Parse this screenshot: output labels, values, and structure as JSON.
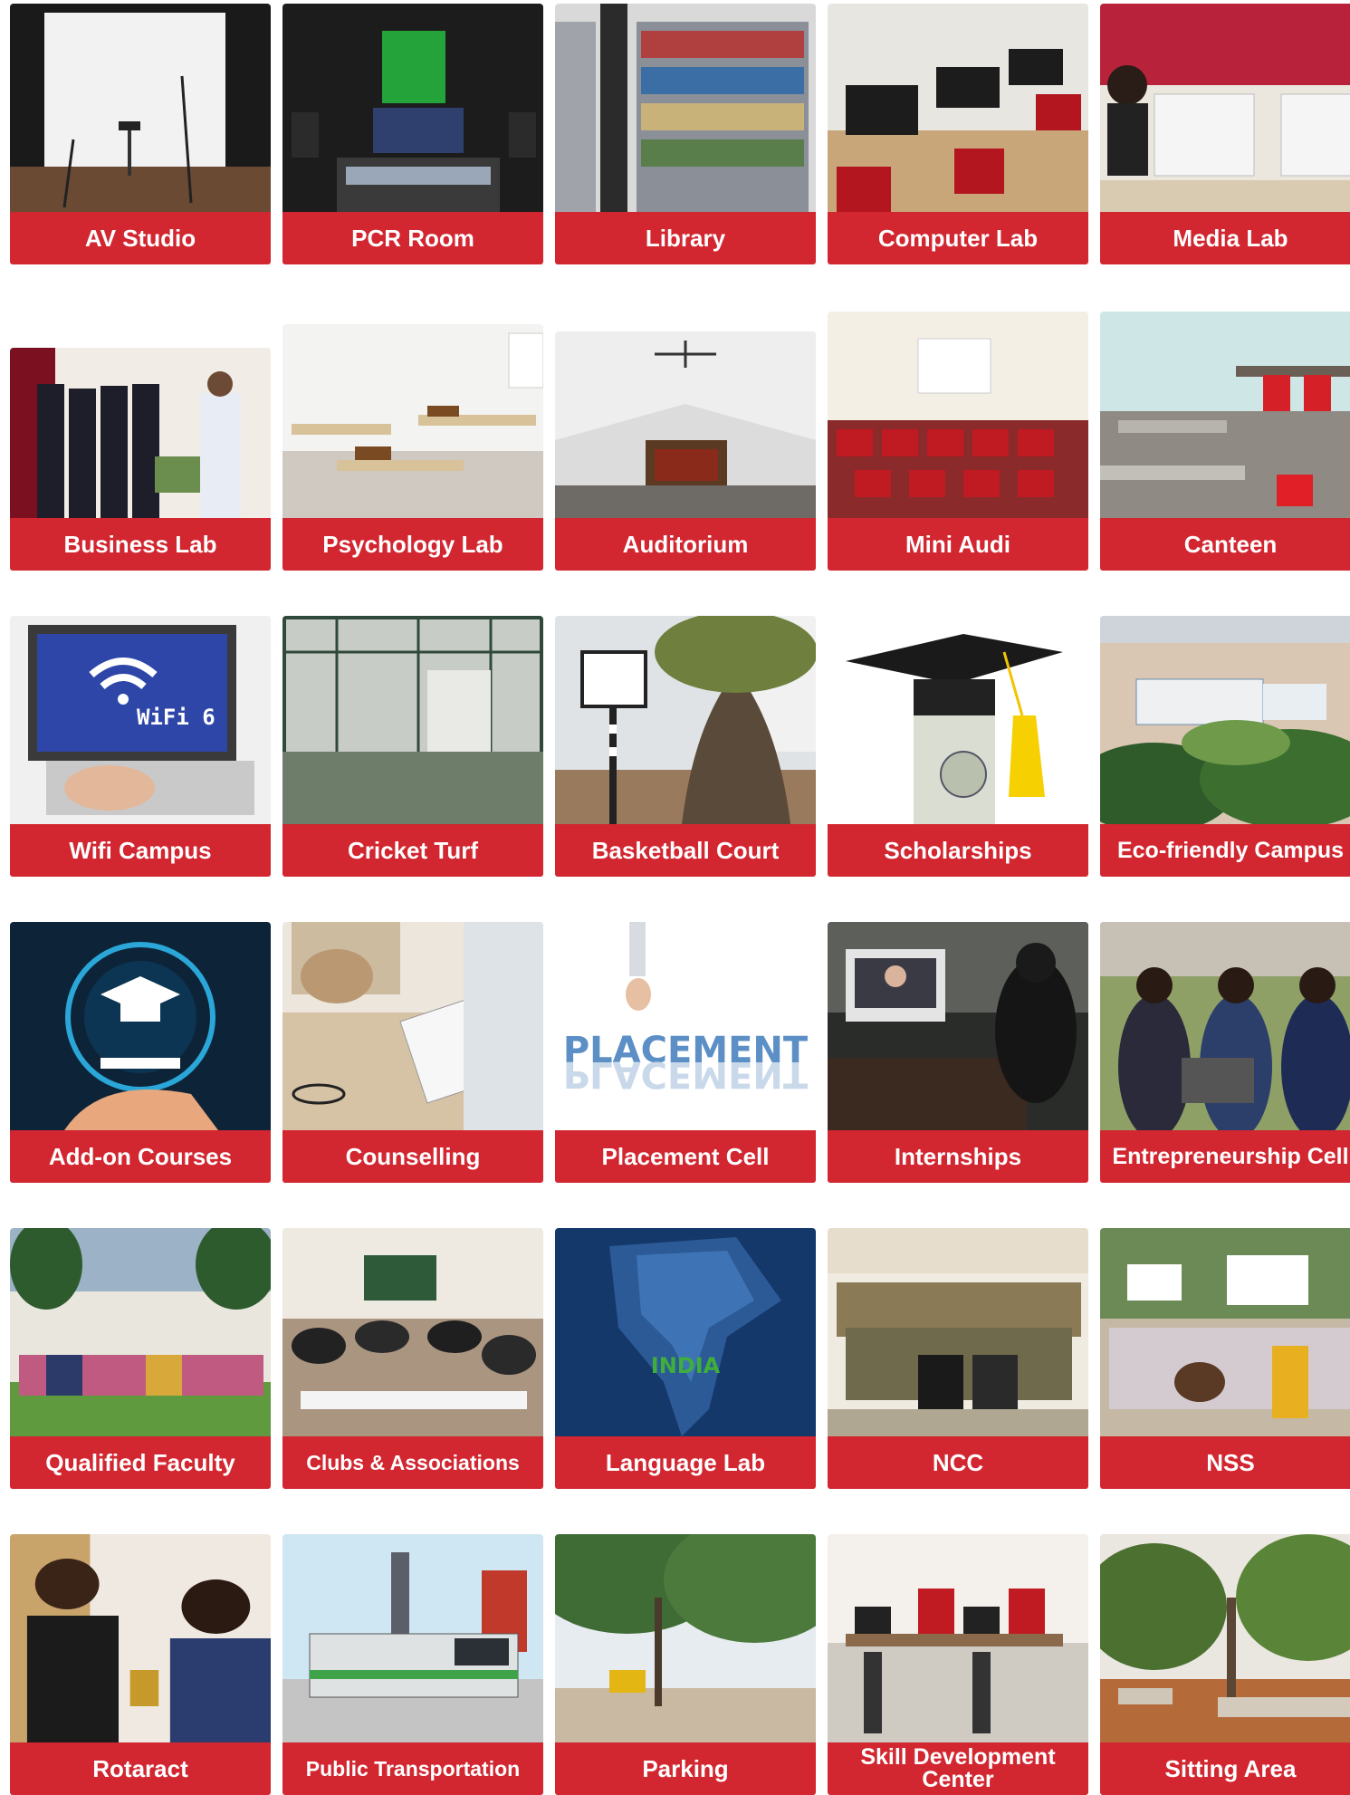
{
  "tiles": [
    {
      "label": "AV Studio",
      "icon": "av-studio-photo"
    },
    {
      "label": "PCR Room",
      "icon": "pcr-room-photo"
    },
    {
      "label": "Library",
      "icon": "library-photo"
    },
    {
      "label": "Computer Lab",
      "icon": "computer-lab-photo"
    },
    {
      "label": "Media Lab",
      "icon": "media-lab-photo"
    },
    {
      "label": "Business Lab",
      "icon": "business-lab-photo"
    },
    {
      "label": "Psychology Lab",
      "icon": "psychology-lab-photo"
    },
    {
      "label": "Auditorium",
      "icon": "auditorium-photo"
    },
    {
      "label": "Mini Audi",
      "icon": "mini-audi-photo"
    },
    {
      "label": "Canteen",
      "icon": "canteen-photo"
    },
    {
      "label": "Wifi Campus",
      "icon": "wifi-campus-photo",
      "image_text": "WiFi 6"
    },
    {
      "label": "Cricket Turf",
      "icon": "cricket-turf-photo"
    },
    {
      "label": "Basketball Court",
      "icon": "basketball-court-photo"
    },
    {
      "label": "Scholarships",
      "icon": "scholarships-photo"
    },
    {
      "label": "Eco-friendly Campus",
      "icon": "eco-friendly-campus-photo"
    },
    {
      "label": "Add-on Courses",
      "icon": "add-on-courses-photo"
    },
    {
      "label": "Counselling",
      "icon": "counselling-photo"
    },
    {
      "label": "Placement Cell",
      "icon": "placement-cell-photo",
      "image_text": "PLACEMENT"
    },
    {
      "label": "Internships",
      "icon": "internships-photo"
    },
    {
      "label": "Entrepreneurship Cell",
      "icon": "entrepreneurship-cell-photo"
    },
    {
      "label": "Qualified Faculty",
      "icon": "qualified-faculty-photo"
    },
    {
      "label": "Clubs & Associations",
      "icon": "clubs-associations-photo"
    },
    {
      "label": "Language Lab",
      "icon": "language-lab-photo",
      "image_text": "INDIA"
    },
    {
      "label": "NCC",
      "icon": "ncc-photo"
    },
    {
      "label": "NSS",
      "icon": "nss-photo"
    },
    {
      "label": "Rotaract",
      "icon": "rotaract-photo"
    },
    {
      "label": "Public Transportation",
      "icon": "public-transportation-photo"
    },
    {
      "label": "Parking",
      "icon": "parking-photo"
    },
    {
      "label": "Skill Development Center",
      "icon": "skill-development-center-photo"
    },
    {
      "label": "Sitting Area",
      "icon": "sitting-area-photo"
    }
  ],
  "colors": {
    "label_background": "#d22630",
    "label_text": "#ffffff",
    "page_background": "#ffffff"
  }
}
